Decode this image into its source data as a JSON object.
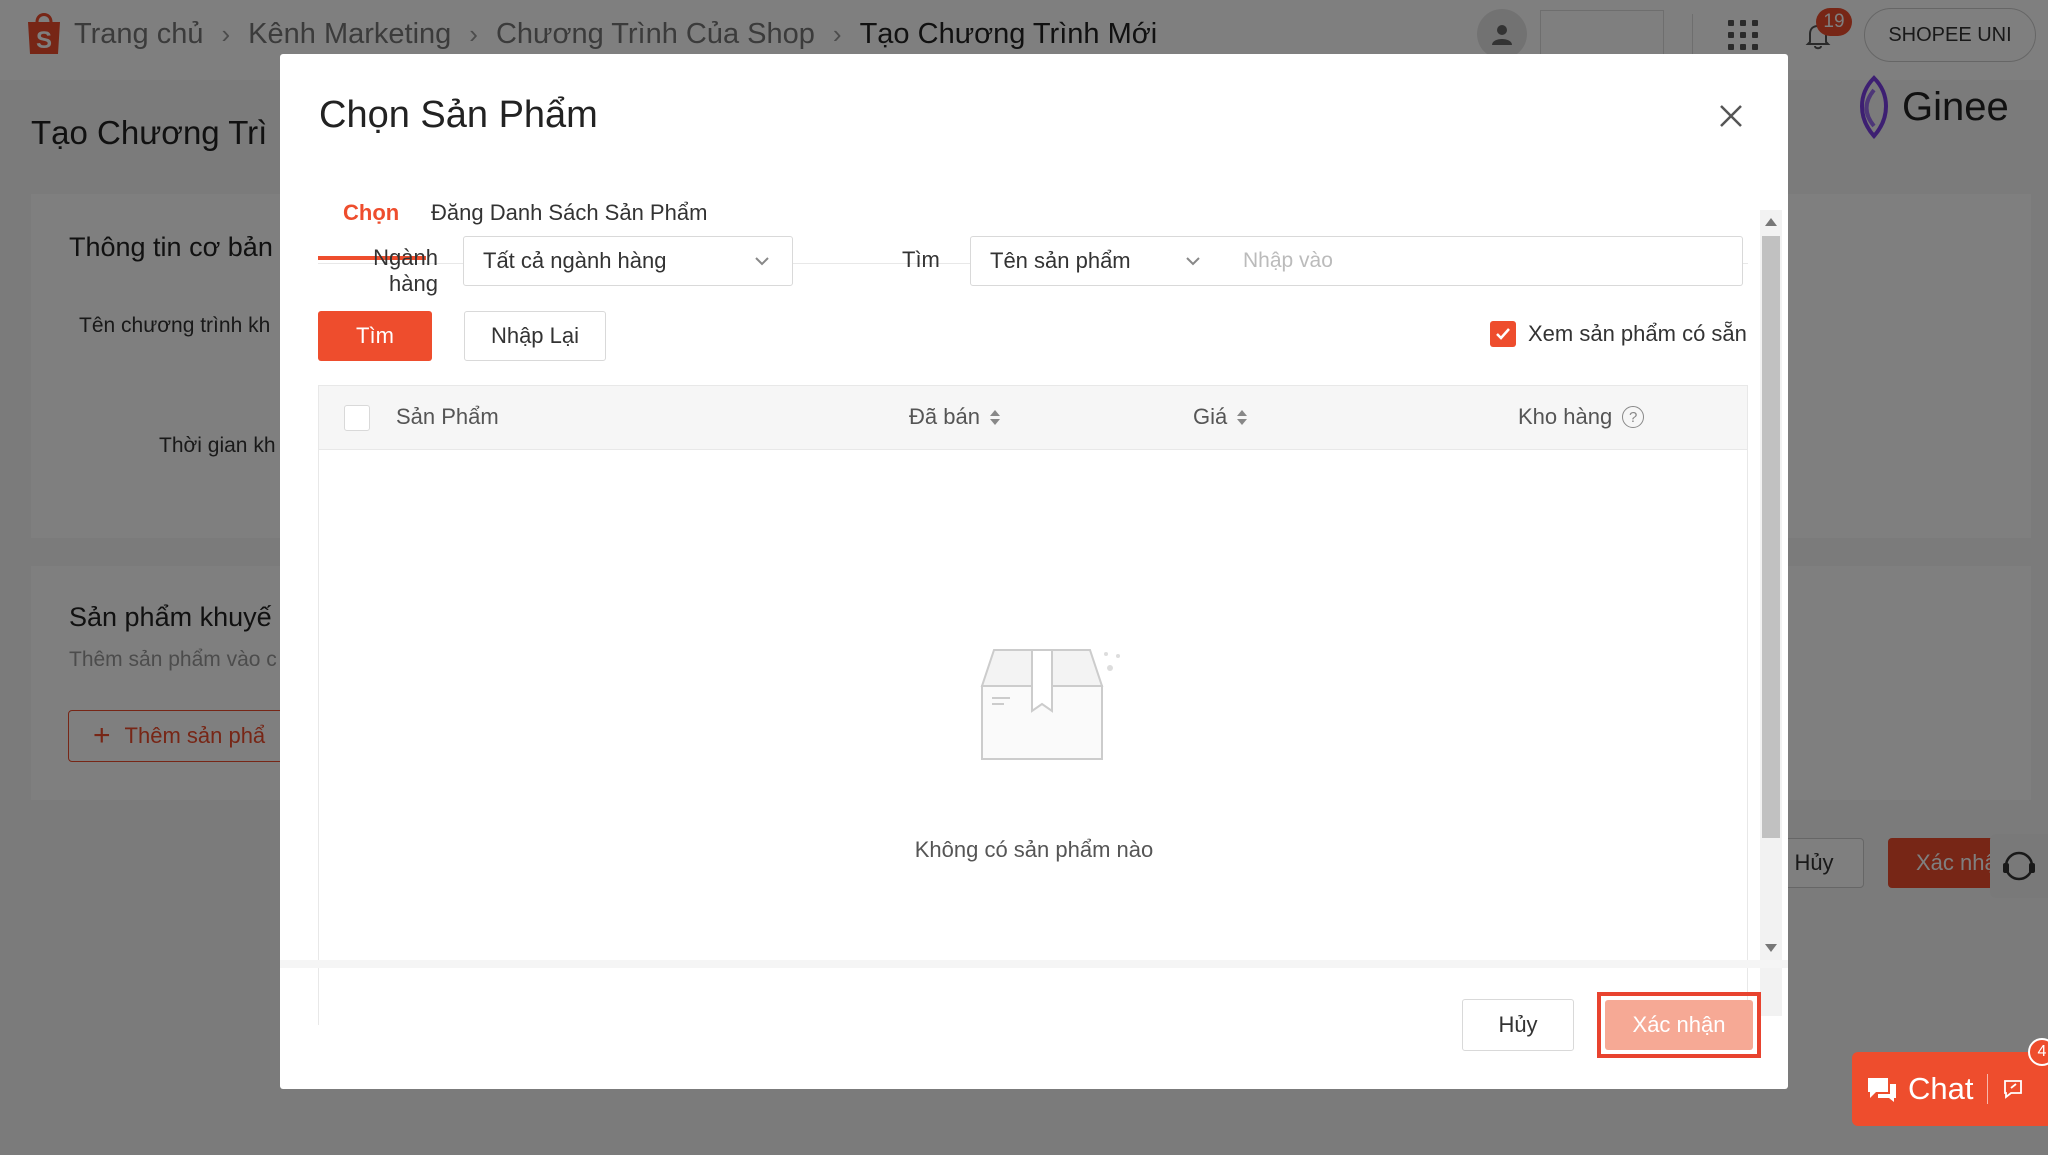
{
  "breadcrumb": {
    "home": "Trang chủ",
    "marketing": "Kênh Marketing",
    "programs": "Chương Trình Của Shop",
    "current": "Tạo Chương Trình Mới"
  },
  "header": {
    "notification_count": "19",
    "shop_name": "SHOPEE UNI"
  },
  "brand": {
    "ginee": "Ginee"
  },
  "background_page": {
    "title": "Tạo Chương Trì",
    "basic_info_title": "Thông tin cơ bản",
    "program_name_label": "Tên chương trình kh",
    "time_label": "Thời gian kh",
    "products_title": "Sản phẩm khuyế",
    "products_sub": "Thêm sản phẩm vào c",
    "add_product": "Thêm sản phẩ",
    "cancel": "Hủy",
    "confirm": "Xác nhậ"
  },
  "chat": {
    "label": "Chat",
    "badge": "4"
  },
  "modal": {
    "title": "Chọn Sản Phẩm",
    "tabs": [
      "Chọn",
      "Đăng Danh Sách Sản Phẩm"
    ],
    "filters": {
      "category_label": "Ngành hàng",
      "category_value": "Tất cả ngành hàng",
      "search_label": "Tìm",
      "search_field": "Tên sản phẩm",
      "search_placeholder": "Nhập vào",
      "search_value": ""
    },
    "buttons": {
      "search": "Tìm",
      "reset": "Nhập Lại"
    },
    "available_only": "Xem sản phẩm có sẵn",
    "table": {
      "columns": [
        "Sản Phẩm",
        "Đã bán",
        "Giá",
        "Kho hàng"
      ],
      "empty_text": "Không có sản phẩm nào"
    },
    "footer": {
      "cancel": "Hủy",
      "confirm": "Xác nhận"
    }
  },
  "colors": {
    "brand": "#ee4d2d",
    "confirm_disabled": "#f6a995",
    "highlight_border": "#e8432f"
  }
}
